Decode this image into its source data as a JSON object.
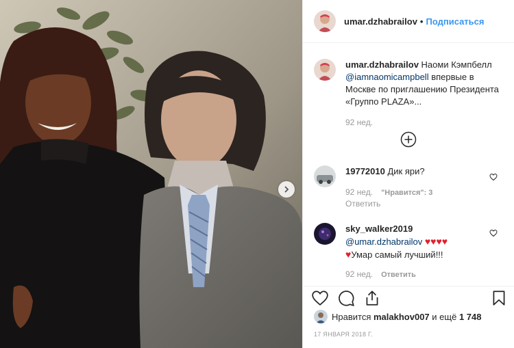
{
  "header": {
    "username": "umar.dzhabrailov",
    "separator": "•",
    "follow_label": "Подписаться"
  },
  "caption": {
    "username": "umar.dzhabrailov",
    "text_before": "Наоми Кэмпбелл",
    "mention": "@iamnaomicampbell",
    "text_after": "впервые в Москве по приглашению Президента «Группо PLAZA»...",
    "time": "92 нед."
  },
  "comments": [
    {
      "username": "19772010",
      "text": "Дик яри?",
      "time": "92 нед.",
      "likes": "\"Нравится\": 3",
      "reply": "Ответить"
    },
    {
      "username": "sky_walker2019",
      "mention": "@umar.dzhabrailov",
      "hearts_line1": "♥♥♥♥",
      "heart_line2": "♥",
      "text": "Умар самый лучший!!!",
      "time": "92 нед.",
      "reply": "Ответить"
    }
  ],
  "likes": {
    "prefix": "Нравится",
    "user": "malakhov007",
    "middle": "и ещё",
    "count": "1 748"
  },
  "date": "17 ЯНВАРЯ 2018 Г.",
  "icons": {
    "like": "heart-icon",
    "comment": "comment-icon",
    "share": "share-icon",
    "save": "bookmark-icon",
    "load_more": "plus-circle-icon",
    "next": "chevron-right-icon"
  },
  "colors": {
    "link": "#3897f0",
    "mention": "#003569",
    "muted": "#999999",
    "heart": "#e0202e"
  }
}
